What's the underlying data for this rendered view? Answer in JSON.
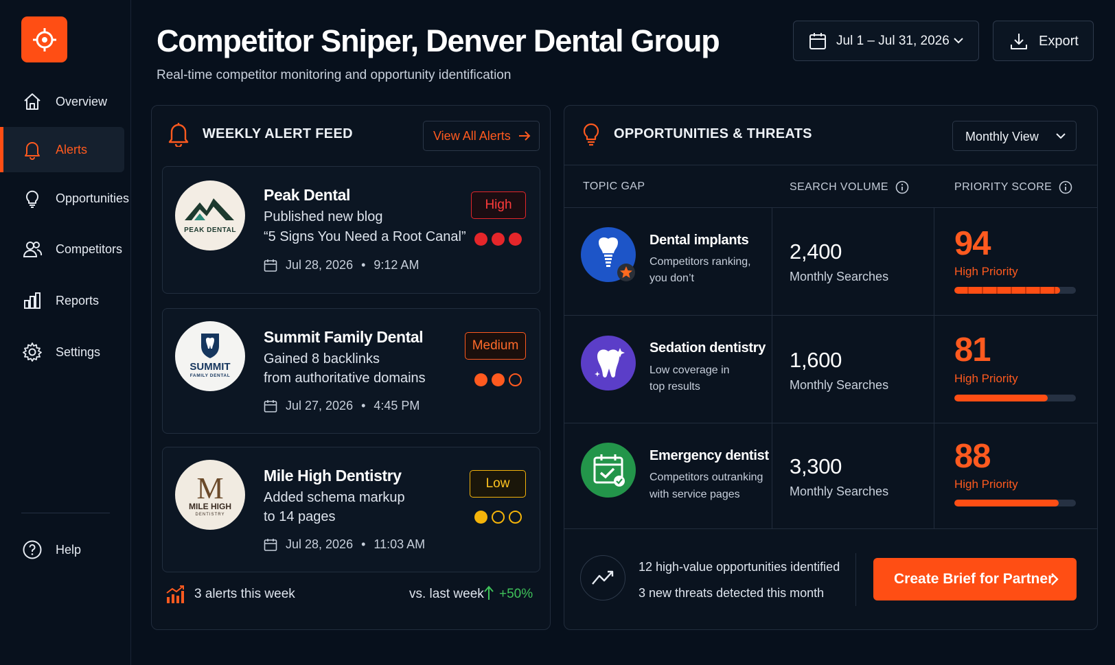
{
  "app": {
    "logo_icon": "crosshair-icon",
    "accent": "#ff4e14"
  },
  "sidebar": {
    "items": [
      {
        "label": "Overview",
        "icon": "home-icon",
        "active": false
      },
      {
        "label": "Alerts",
        "icon": "bell-icon",
        "active": true
      },
      {
        "label": "Opportunities",
        "icon": "lightbulb-icon",
        "active": false
      },
      {
        "label": "Competitors",
        "icon": "users-icon",
        "active": false
      },
      {
        "label": "Reports",
        "icon": "bar-chart-icon",
        "active": false
      },
      {
        "label": "Settings",
        "icon": "gear-icon",
        "active": false
      }
    ],
    "help_label": "Help"
  },
  "header": {
    "title": "Competitor Sniper, Denver Dental Group",
    "subtitle": "Real-time competitor monitoring and opportunity identification",
    "date_range": "Jul 1 – Jul 31, 2026",
    "export_label": "Export"
  },
  "alert_feed": {
    "title": "WEEKLY ALERT FEED",
    "view_all_label": "View All Alerts",
    "alerts": [
      {
        "competitor": "Peak Dental",
        "logo_text": "PEAK DENTAL",
        "line1": "Published new blog",
        "line2": "“5 Signs You Need a Root Canal”",
        "date": "Jul 28, 2026",
        "time": "9:12 AM",
        "severity": "High",
        "severity_level": 3,
        "severity_color": "#e5262a"
      },
      {
        "competitor": "Summit Family Dental",
        "logo_text": "SUMMIT",
        "logo_subtext": "FAMILY DENTAL",
        "line1": "Gained 8 backlinks",
        "line2": "from authoritative domains",
        "date": "Jul 27, 2026",
        "time": "4:45 PM",
        "severity": "Medium",
        "severity_level": 2,
        "severity_color": "#ff5a1f"
      },
      {
        "competitor": "Mile High Dentistry",
        "logo_letter": "M",
        "logo_text": "MILE HIGH",
        "logo_subtext": "DENTISTRY",
        "line1": "Added schema markup",
        "line2": "to 14 pages",
        "date": "Jul 28, 2026",
        "time": "11:03 AM",
        "severity": "Low",
        "severity_level": 1,
        "severity_color": "#f5b40a"
      }
    ],
    "footer": {
      "count_label": "3 alerts this week",
      "vs_label": "vs. last week",
      "change": "+50%"
    }
  },
  "opportunities": {
    "title": "OPPORTUNITIES & THREATS",
    "view_select": "Monthly View",
    "columns": [
      "TOPIC GAP",
      "SEARCH VOLUME",
      "PRIORITY SCORE"
    ],
    "rows": [
      {
        "topic": "Dental implants",
        "desc1": "Competitors ranking,",
        "desc2": "you don’t",
        "icon": "tooth-implant-icon",
        "icon_color": "#1d55c8",
        "volume": "2,400",
        "volume_label": "Monthly Searches",
        "score": "94",
        "score_label": "High Priority",
        "score_fraction": 0.87
      },
      {
        "topic": "Sedation dentistry",
        "desc1": "Low coverage in",
        "desc2": "top results",
        "icon": "sparkle-tooth-icon",
        "icon_color": "#5b3ec8",
        "volume": "1,600",
        "volume_label": "Monthly Searches",
        "score": "81",
        "score_label": "High Priority",
        "score_fraction": 0.77
      },
      {
        "topic": "Emergency dentist",
        "desc1": "Competitors outranking",
        "desc2": "with service pages",
        "icon": "calendar-check-icon",
        "icon_color": "#23954a",
        "volume": "3,300",
        "volume_label": "Monthly Searches",
        "score": "88",
        "score_label": "High Priority",
        "score_fraction": 0.86
      }
    ],
    "summary": {
      "line1": "12 high-value opportunities identified",
      "line2": "3 new threats detected this month"
    },
    "cta_label": "Create Brief for Partner"
  }
}
